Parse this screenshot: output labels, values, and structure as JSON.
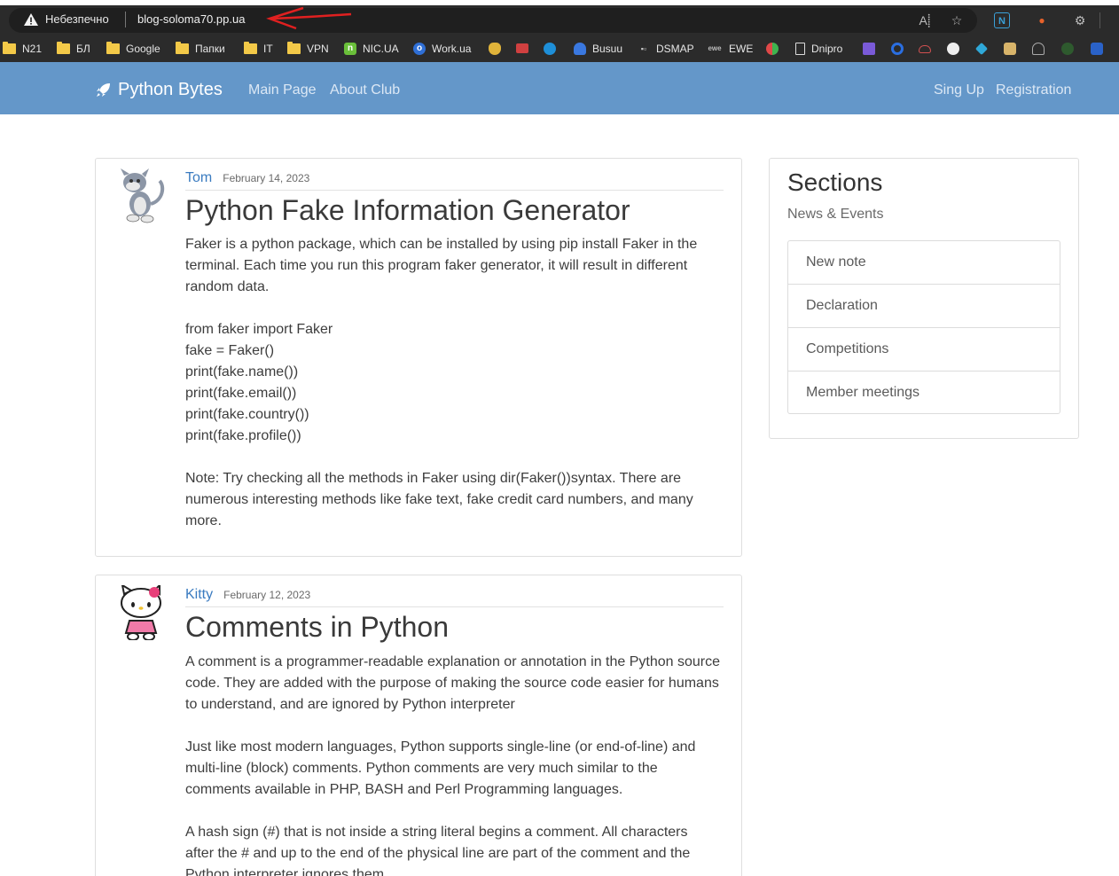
{
  "browser": {
    "security_label": "Небезпечно",
    "url": "blog-soloma70.pp.ua",
    "toolbar_icons": [
      "read-aloud-icon",
      "favorites-add-icon",
      "extension-n-icon",
      "extension-fox-icon",
      "extensions-icon"
    ],
    "bookmarks": [
      {
        "label": "N21",
        "icon": "folder-icon"
      },
      {
        "label": "БЛ",
        "icon": "folder-icon"
      },
      {
        "label": "Google",
        "icon": "folder-icon"
      },
      {
        "label": "Папки",
        "icon": "folder-icon"
      },
      {
        "label": "IT",
        "icon": "folder-icon"
      },
      {
        "label": "VPN",
        "icon": "folder-icon"
      },
      {
        "label": "NIC.UA",
        "icon": "nic-icon"
      },
      {
        "label": "Work.ua",
        "icon": "workua-icon"
      },
      {
        "label": "Busuu",
        "icon": "busuu-icon"
      },
      {
        "label": "DSMAP",
        "icon": "dsmap-icon"
      },
      {
        "label": "EWE",
        "icon": "ewe-icon"
      },
      {
        "label": "Dnipro",
        "icon": "page-icon"
      }
    ]
  },
  "site": {
    "brand": "Python Bytes",
    "nav_left": [
      "Main Page",
      "About Club"
    ],
    "nav_right": [
      "Sing Up",
      "Registration"
    ]
  },
  "posts": [
    {
      "author": "Tom",
      "date": "February 14, 2023",
      "title": "Python Fake Information Generator",
      "body": "Faker is a python package, which can be installed by using pip install Faker in the\nterminal. Each time you run this program faker generator, it will result in different\nrandom data.\n\nfrom faker import Faker\nfake = Faker()\nprint(fake.name())\nprint(fake.email())\nprint(fake.country())\nprint(fake.profile())\n\nNote: Try checking all the methods in Faker using dir(Faker())syntax. There are\nnumerous interesting methods like fake text, fake credit card numbers, and many\nmore."
    },
    {
      "author": "Kitty",
      "date": "February 12, 2023",
      "title": "Comments in Python",
      "body": "A comment is a programmer-readable explanation or annotation in the Python source\ncode. They are added with the purpose of making the source code easier for humans\nto understand, and are ignored by Python interpreter\n\nJust like most modern languages, Python supports single-line (or end-of-line) and\nmulti-line (block) comments. Python comments are very much similar to the\ncomments available in PHP, BASH and Perl Programming languages.\n\nA hash sign (#) that is not inside a string literal begins a comment. All characters\nafter the # and up to the end of the physical line are part of the comment and the\nPython interpreter ignores them."
    }
  ],
  "sidebar": {
    "title": "Sections",
    "subtitle": "News & Events",
    "items": [
      "New note",
      "Declaration",
      "Competitions",
      "Member meetings"
    ]
  },
  "colors": {
    "navbar": "#6497c9",
    "author_link": "#3a7bc0"
  }
}
